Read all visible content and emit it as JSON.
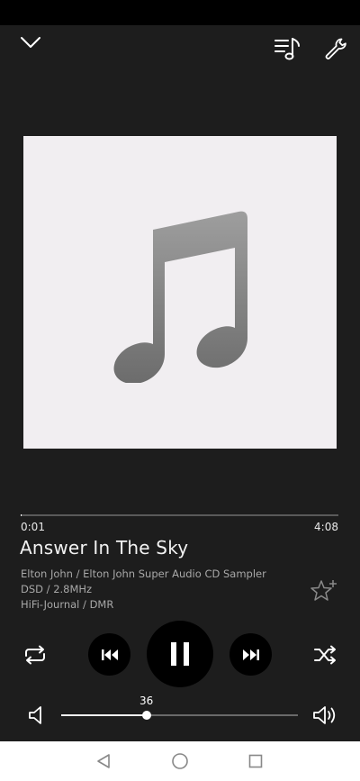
{
  "track": {
    "elapsed": "0:01",
    "duration": "4:08",
    "progress_fraction": 0.003,
    "title": "Answer In The Sky",
    "artist_album": "Elton John / Elton John Super Audio CD Sampler",
    "format": "DSD / 2.8MHz",
    "source": "HiFi-Journal / DMR"
  },
  "volume": {
    "value": "36",
    "fraction": 0.36
  },
  "icons": {
    "collapse": "chevron-down-icon",
    "queue": "playlist-music-icon",
    "settings": "wrench-icon",
    "artwork": "music-note-icon",
    "favorite": "star-plus-icon",
    "repeat": "repeat-icon",
    "previous": "skip-previous-icon",
    "play_pause": "pause-icon",
    "next": "skip-next-icon",
    "shuffle": "shuffle-icon",
    "volume_low": "volume-low-icon",
    "volume_high": "volume-high-icon",
    "nav_back": "triangle-back-icon",
    "nav_home": "circle-home-icon",
    "nav_recents": "square-recents-icon"
  },
  "colors": {
    "background": "#1d1d1d",
    "artwork_bg": "#f1eef1",
    "button_bg": "#000000",
    "nav_bg": "#ffffff"
  }
}
